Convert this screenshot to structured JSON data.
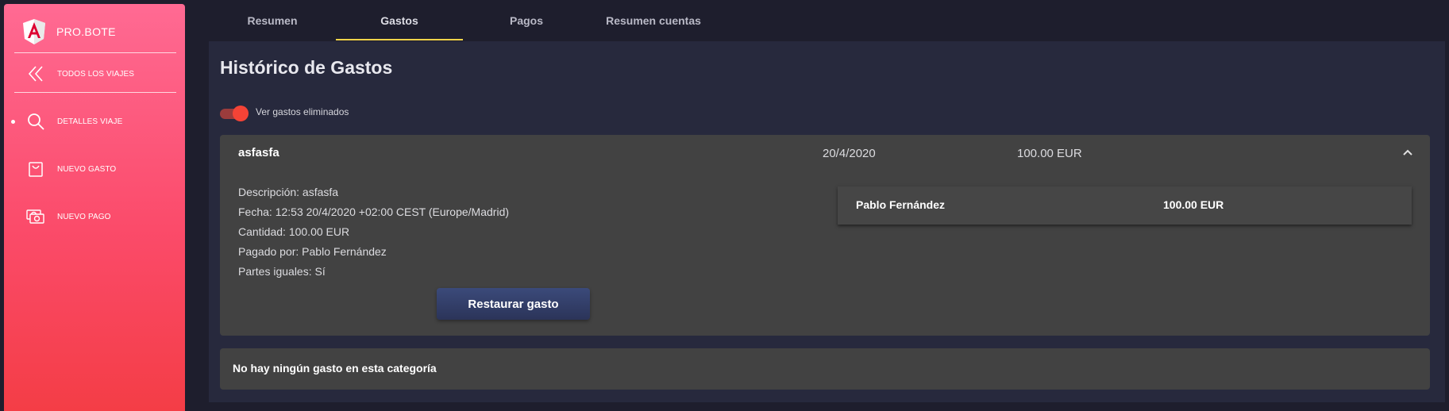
{
  "sidebar": {
    "brand": "PRO.BOTE",
    "items": [
      {
        "label": "TODOS LOS VIAJES",
        "icon": "double-chevron-left-icon"
      },
      {
        "label": "DETALLES VIAJE",
        "icon": "search-icon",
        "active": true
      },
      {
        "label": "NUEVO GASTO",
        "icon": "shopping-bag-icon"
      },
      {
        "label": "NUEVO PAGO",
        "icon": "money-icon"
      }
    ]
  },
  "tabs": [
    {
      "label": "Resumen"
    },
    {
      "label": "Gastos",
      "active": true
    },
    {
      "label": "Pagos"
    },
    {
      "label": "Resumen cuentas"
    }
  ],
  "main": {
    "title": "Histórico de Gastos",
    "toggle_label": "Ver gastos eliminados",
    "toggle_on": true,
    "expense": {
      "title": "asfasfa",
      "date": "20/4/2020",
      "amount": "100.00 EUR",
      "details": [
        "Descripción: asfasfa",
        "Fecha: 12:53 20/4/2020 +02:00 CEST (Europe/Madrid)",
        "Cantidad: 100.00 EUR",
        "Pagado por: Pablo Fernández",
        "Partes iguales: Sí"
      ],
      "restore_button": "Restaurar gasto",
      "participants": [
        {
          "name": "Pablo Fernández",
          "amount": "100.00 EUR"
        }
      ]
    },
    "empty_message": "No hay ningún gasto en esta categoría"
  },
  "colors": {
    "sidebar_top": "#ff6a93",
    "sidebar_bottom": "#f43d46",
    "tab_underline": "#f3d34a",
    "toggle": "#f44336",
    "button": "#2b3459"
  }
}
